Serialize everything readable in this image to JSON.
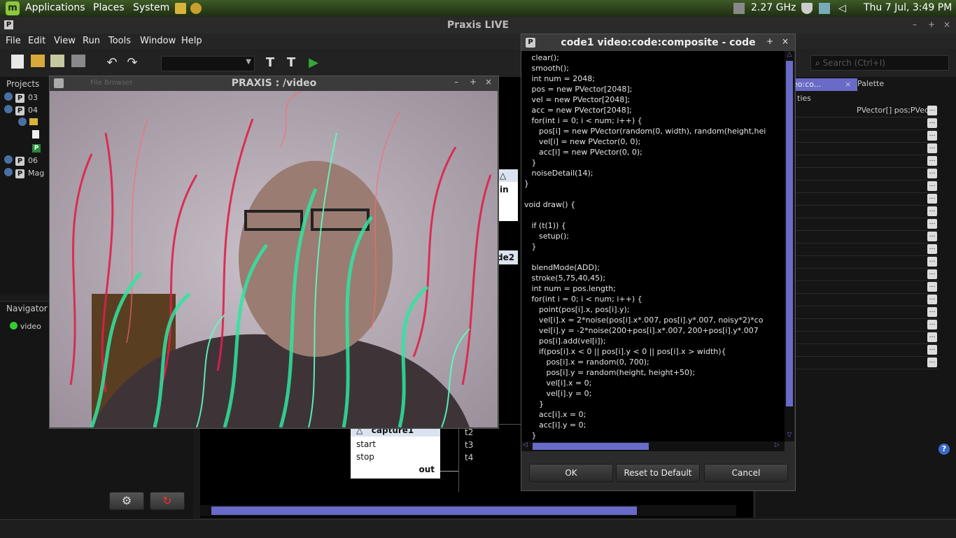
{
  "top_panel": {
    "menus": [
      "Applications",
      "Places",
      "System"
    ],
    "cpu_freq": "2.27 GHz",
    "clock": "Thu  7 Jul,  3:49 PM"
  },
  "window": {
    "title": "Praxis LIVE"
  },
  "menubar": [
    "File",
    "Edit",
    "View",
    "Run",
    "Tools",
    "Window",
    "Help"
  ],
  "search": {
    "placeholder": "Search (Ctrl+I)"
  },
  "projects": {
    "title": "Projects",
    "items": [
      "03",
      "04",
      "06",
      "Mag"
    ]
  },
  "file_browser_tab": "File Browser",
  "navigator": {
    "title": "Navigator",
    "item": "video"
  },
  "graph": {
    "nodes": {
      "in_label": "in",
      "code2_label": "de2",
      "capture": {
        "name": "capture1",
        "ports": [
          "start",
          "stop"
        ],
        "out": "out"
      },
      "t_ports": [
        "t2",
        "t3",
        "t4"
      ]
    }
  },
  "right_panel": {
    "tab_label": "eo:co...",
    "palette_label": "Palette",
    "properties_label": "ties",
    "first_prop_value": "PVector[] pos;PVec..."
  },
  "video_window": {
    "title": "PRAXIS : /video"
  },
  "code_dialog": {
    "title": "code1 video:code:composite - code",
    "lines": [
      "   clear();",
      "   smooth();",
      "   int num = 2048;",
      "   pos = new PVector[2048];",
      "   vel = new PVector[2048];",
      "   acc = new PVector[2048];",
      "   for(int i = 0; i < num; i++) {",
      "      pos[i] = new PVector(random(0, width), random(height,hei",
      "      vel[i] = new PVector(0, 0);",
      "      acc[i] = new PVector(0, 0);",
      "   }",
      "   noiseDetail(14);",
      "}",
      "",
      "void draw() {",
      "",
      "   if (t(1)) {",
      "      setup();",
      "   }",
      "",
      "   blendMode(ADD);",
      "   stroke(5,75,40,45);",
      "   int num = pos.length;",
      "   for(int i = 0; i < num; i++) {",
      "      point(pos[i].x, pos[i].y);",
      "      vel[i].x = 2*noise(pos[i].x*.007, pos[i].y*.007, noisy*2)*co",
      "      vel[i].y = -2*noise(200+pos[i].x*.007, 200+pos[i].y*.007",
      "      pos[i].add(vel[i]);",
      "      if(pos[i].x < 0 || pos[i].y < 0 || pos[i].x > width){",
      "         pos[i].x = random(0, 700);",
      "         pos[i].y = random(height, height+50);",
      "         vel[i].x = 0;",
      "         vel[i].y = 0;",
      "      }",
      "      acc[i].x = 0;",
      "      acc[i].y = 0;",
      "   }"
    ],
    "buttons": {
      "ok": "OK",
      "reset": "Reset to Default",
      "cancel": "Cancel"
    }
  },
  "colors": {
    "accent": "#6a6ac8",
    "panel_green": "#3d5a25",
    "code_bg": "#000000"
  }
}
